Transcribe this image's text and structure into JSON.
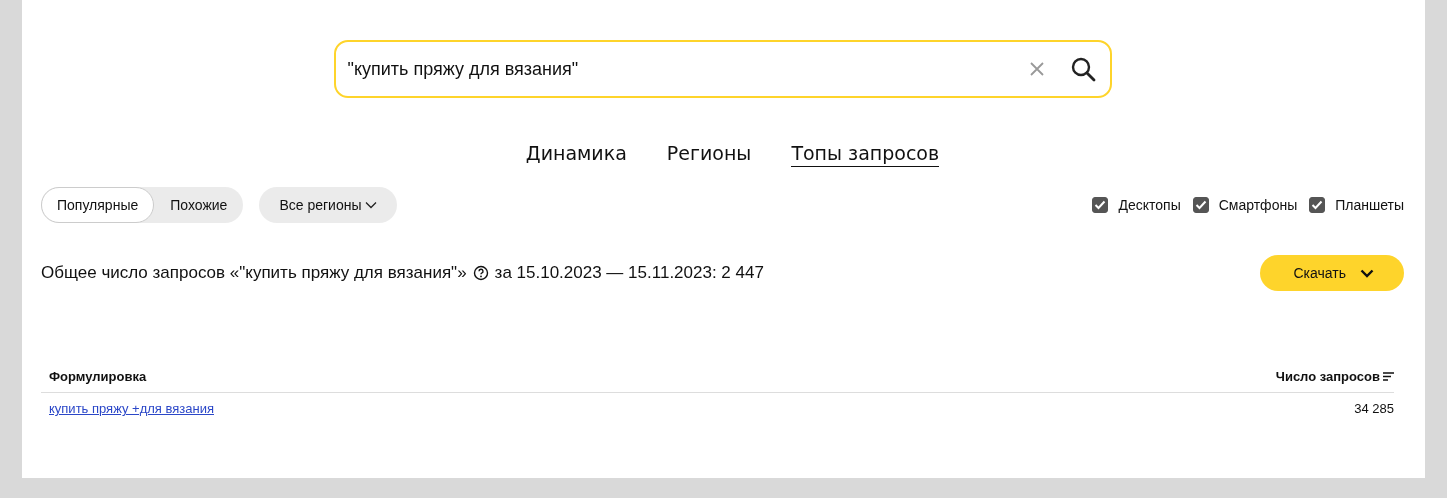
{
  "search": {
    "value": "\"купить пряжу для вязания\""
  },
  "tabs": [
    {
      "label": "Динамика",
      "selected": false
    },
    {
      "label": "Регионы",
      "selected": false
    },
    {
      "label": "Топы запросов",
      "selected": true
    }
  ],
  "segments": [
    {
      "label": "Популярные",
      "selected": true
    },
    {
      "label": "Похожие",
      "selected": false
    }
  ],
  "region_dropdown": {
    "label": "Все регионы"
  },
  "devices": [
    {
      "label": "Десктопы",
      "checked": true
    },
    {
      "label": "Смартфоны",
      "checked": true
    },
    {
      "label": "Планшеты",
      "checked": true
    }
  ],
  "summary": {
    "before": "Общее число запросов «\"купить пряжу для вязания\"»",
    "after": "за 15.10.2023 — 15.11.2023: 2 447"
  },
  "download_button": {
    "label": "Скачать"
  },
  "table": {
    "columns": [
      "Формулировка",
      "Число запросов"
    ],
    "rows": [
      {
        "phrase": "купить пряжу +для вязания",
        "count": "34 285"
      }
    ]
  }
}
